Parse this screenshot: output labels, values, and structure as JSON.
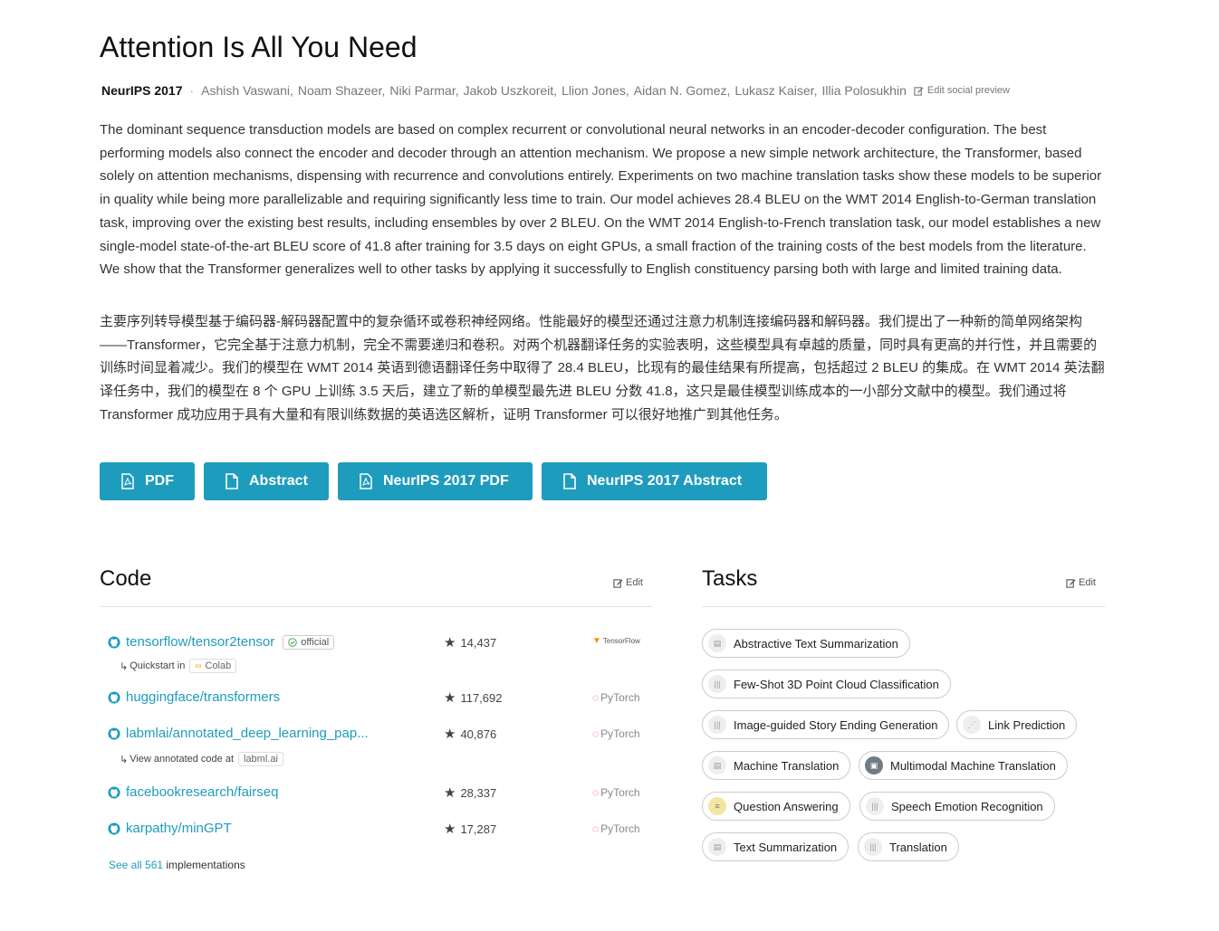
{
  "paper": {
    "title": "Attention Is All You Need",
    "venue": "NeurIPS 2017",
    "authors": [
      "Ashish Vaswani,",
      "Noam Shazeer,",
      "Niki Parmar,",
      "Jakob Uszkoreit,",
      "Llion Jones,",
      "Aidan N. Gomez,",
      "Lukasz Kaiser,",
      "Illia Polosukhin"
    ],
    "edit_social": "Edit social preview",
    "abstract_en": "The dominant sequence transduction models are based on complex recurrent or convolutional neural networks in an encoder-decoder configuration. The best performing models also connect the encoder and decoder through an attention mechanism. We propose a new simple network architecture, the Transformer, based solely on attention mechanisms, dispensing with recurrence and convolutions entirely. Experiments on two machine translation tasks show these models to be superior in quality while being more parallelizable and requiring significantly less time to train. Our model achieves 28.4 BLEU on the WMT 2014 English-to-German translation task, improving over the existing best results, including ensembles by over 2 BLEU. On the WMT 2014 English-to-French translation task, our model establishes a new single-model state-of-the-art BLEU score of 41.8 after training for 3.5 days on eight GPUs, a small fraction of the training costs of the best models from the literature. We show that the Transformer generalizes well to other tasks by applying it successfully to English constituency parsing both with large and limited training data.",
    "abstract_zh": "主要序列转导模型基于编码器-解码器配置中的复杂循环或卷积神经网络。性能最好的模型还通过注意力机制连接编码器和解码器。我们提出了一种新的简单网络架构——Transformer，它完全基于注意力机制，完全不需要递归和卷积。对两个机器翻译任务的实验表明，这些模型具有卓越的质量，同时具有更高的并行性，并且需要的训练时间显着减少。我们的模型在 WMT 2014 英语到德语翻译任务中取得了 28.4 BLEU，比现有的最佳结果有所提高，包括超过 2 BLEU 的集成。在 WMT 2014 英法翻译任务中，我们的模型在 8 个 GPU 上训练 3.5 天后，建立了新的单模型最先进 BLEU 分数 41.8，这只是最佳模型训练成本的一小部分文献中的模型。我们通过将 Transformer 成功应用于具有大量和有限训练数据的英语选区解析，证明 Transformer 可以很好地推广到其他任务。"
  },
  "buttons": {
    "pdf": "PDF",
    "abstract": "Abstract",
    "neurips_pdf": "NeurIPS 2017 PDF",
    "neurips_abstract": "NeurIPS 2017 Abstract"
  },
  "code": {
    "title": "Code",
    "edit": "Edit",
    "repos": [
      {
        "name": "tensorflow/tensor2tensor",
        "stars": "14,437",
        "framework": "TensorFlow",
        "badge": "official"
      },
      {
        "name": "huggingface/transformers",
        "stars": "117,692",
        "framework": "PyTorch"
      },
      {
        "name": "labmlai/annotated_deep_learning_pap...",
        "stars": "40,876",
        "framework": "PyTorch"
      },
      {
        "name": "facebookresearch/fairseq",
        "stars": "28,337",
        "framework": "PyTorch"
      },
      {
        "name": "karpathy/minGPT",
        "stars": "17,287",
        "framework": "PyTorch"
      }
    ],
    "quickstart_label": "Quickstart in",
    "colab": "Colab",
    "annotated_label": "View annotated code at",
    "labml": "labml.ai",
    "see_all_link": "See all 561",
    "see_all_rest": " implementations"
  },
  "tasks": {
    "title": "Tasks",
    "edit": "Edit",
    "items": [
      "Abstractive Text Summarization",
      "Few-Shot 3D Point Cloud Classification",
      "Image-guided Story Ending Generation",
      "Link Prediction",
      "Machine Translation",
      "Multimodal Machine Translation",
      "Question Answering",
      "Speech Emotion Recognition",
      "Text Summarization",
      "Translation"
    ]
  },
  "colors": {
    "accent": "#1e9cbd",
    "pytorch": "#ee4c2c",
    "tensorflow": "#ff8f00"
  }
}
